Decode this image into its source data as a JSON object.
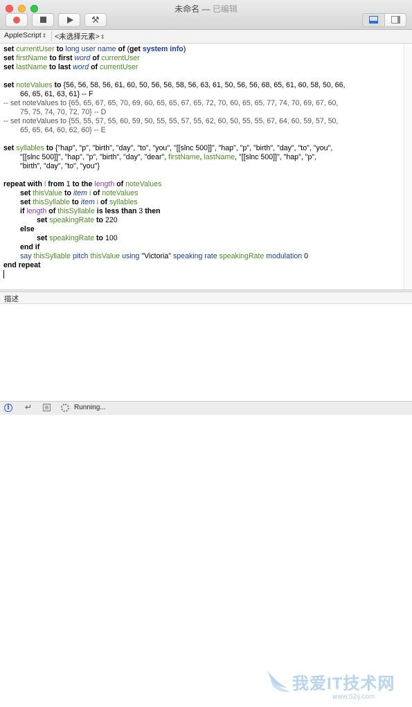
{
  "window": {
    "title": "未命名",
    "separator": " — ",
    "state": "已编辑"
  },
  "toolbar": {
    "buttons": [
      {
        "name": "record",
        "icon": "record-icon"
      },
      {
        "name": "stop",
        "icon": "stop-icon"
      },
      {
        "name": "run",
        "icon": "play-icon"
      },
      {
        "name": "compile",
        "icon": "hammer-icon"
      }
    ],
    "view": {
      "bottom_icon": "bottom-panel-icon",
      "side_icon": "side-panel-icon",
      "accent": "#2d6fd8"
    }
  },
  "navbar": {
    "language": "AppleScript",
    "element": "<未选择元素>"
  },
  "code": {
    "l1": [
      "set",
      "currentUser",
      "to",
      "long user name",
      "of",
      "(",
      "get",
      "system info",
      ")"
    ],
    "l2": [
      "set",
      "firstName",
      "to",
      "first",
      "word",
      "of",
      "currentUser"
    ],
    "l3": [
      "set",
      "lastName",
      "to",
      "last",
      "word",
      "of",
      "currentUser"
    ],
    "l5a": [
      "set",
      "noteValues",
      "to",
      "{56, 56, 58, 56, 61, 60, 50, 56, 56, 58, 56, 63, 61, 50, 56, 56, 68, 65, 61, 60, 58, 50, 66,"
    ],
    "l5b": "66, 65, 61, 63, 61} -- F",
    "l6a": "-- set noteValues to {65, 65, 67, 65, 70, 69, 60, 65, 65, 67, 65, 72, 70, 60, 65, 65, 77, 74, 70, 69, 67, 60,",
    "l6b": "75, 75, 74, 70, 72, 70} -- D",
    "l7a": "-- set noteValues to {55, 55, 57, 55, 60, 59, 50, 55, 55, 57, 55, 62, 60, 50, 55, 55, 67, 64, 60, 59, 57, 50,",
    "l7b": "65, 65, 64, 60, 62, 60} -- E",
    "l9a": [
      "set",
      "syllables",
      "to",
      "{\"hap\", \"p\", \"birth\", \"day\", \"to\", \"you\", \"[[slnc 500]]\", \"hap\", \"p\", \"birth\", \"day\", \"to\", \"you\","
    ],
    "l9b": [
      "\"[[slnc 500]]\", \"hap\", \"p\", \"birth\", \"day\", \"dear\", ",
      "firstName",
      ", ",
      "lastName",
      ", \"[[slnc 500]]\", \"hap\", \"p\","
    ],
    "l9c": "\"birth\", \"day\", \"to\", \"you\"}",
    "l11": [
      "repeat with",
      "i",
      "from",
      "1",
      "to the",
      "length",
      "of",
      "noteValues"
    ],
    "l12": [
      "set",
      "thisValue",
      "to",
      "item",
      "i",
      "of",
      "noteValues"
    ],
    "l13": [
      "set",
      "thisSyllable",
      "to",
      "item",
      "i",
      "of",
      "syllables"
    ],
    "l14": [
      "if",
      "length",
      "of",
      "thisSyllable",
      "is less than",
      "3",
      "then"
    ],
    "l15": [
      "set",
      "speakingRate",
      "to",
      "220"
    ],
    "l16": "else",
    "l17": [
      "set",
      "speakingRate",
      "to",
      "100"
    ],
    "l18": "end if",
    "l19": [
      "say",
      "thisSyllable",
      "pitch",
      "thisValue",
      "using",
      "\"Victoria\"",
      "speaking rate",
      "speakingRate",
      "modulation",
      "0"
    ],
    "l20": "end repeat"
  },
  "description_label": "描述",
  "status": {
    "info_glyph": "i",
    "reply_glyph": "↵",
    "running": "Running..."
  },
  "watermark": {
    "text": "我爱IT技术网",
    "url": "www.52ij.com",
    "color": "#9fc7ea"
  }
}
